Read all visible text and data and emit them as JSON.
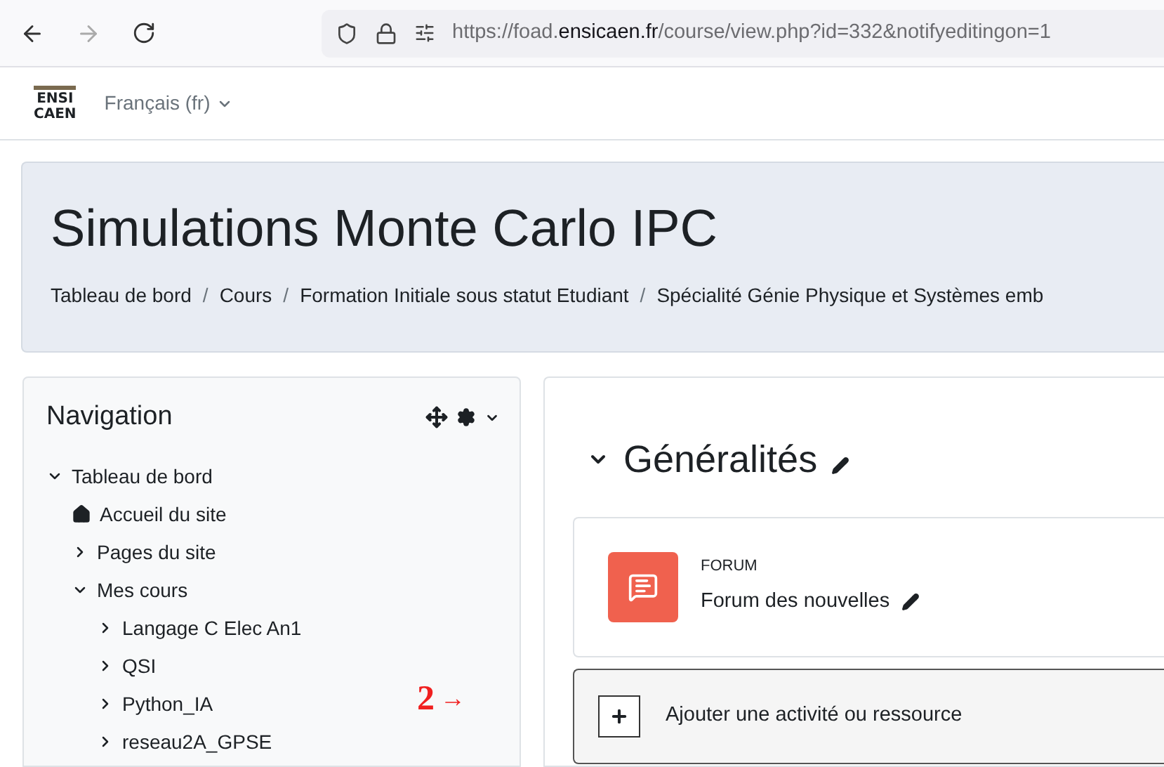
{
  "browser": {
    "url": {
      "prefix": "https://foad.",
      "domain": "ensicaen.fr",
      "path": "/course/view.php?id=332&notifyeditingon=1"
    }
  },
  "header": {
    "logo": [
      "ENSI",
      "CAEN"
    ],
    "language": "Français (fr)"
  },
  "banner": {
    "title": "Simulations Monte Carlo IPC",
    "breadcrumb": [
      {
        "label": "Tableau de bord"
      },
      {
        "separator": "/",
        "label": "Cours"
      },
      {
        "separator": "/",
        "label": "Formation Initiale sous statut Etudiant"
      },
      {
        "separator": "/",
        "label": "Spécialité Génie Physique et Systèmes emb"
      }
    ]
  },
  "navigation": {
    "title": "Navigation",
    "items": [
      {
        "label": "Tableau de bord",
        "kind": "branch",
        "expanded": true,
        "children": [
          {
            "label": "Accueil du site",
            "kind": "home"
          },
          {
            "label": "Pages du site",
            "kind": "branch",
            "expanded": false
          },
          {
            "label": "Mes cours",
            "kind": "branch",
            "expanded": true,
            "children": [
              {
                "label": "Langage C Elec An1",
                "kind": "branch",
                "expanded": false
              },
              {
                "label": "QSI",
                "kind": "branch",
                "expanded": false
              },
              {
                "label": "Python_IA",
                "kind": "branch",
                "expanded": false
              },
              {
                "label": "reseau2A_GPSE",
                "kind": "branch",
                "expanded": false
              }
            ]
          }
        ]
      }
    ]
  },
  "annotation": {
    "number": "2",
    "arrow": "→"
  },
  "section": {
    "title": "Généralités",
    "expanded": true,
    "activity": {
      "type": "FORUM",
      "name": "Forum des nouvelles"
    },
    "add_button": "Ajouter une activité ou ressource"
  }
}
